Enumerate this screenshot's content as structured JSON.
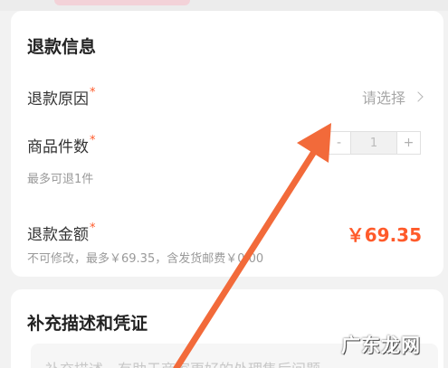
{
  "refund_info": {
    "title": "退款信息",
    "reason_label": "退款原因",
    "reason_placeholder": "请选择",
    "quantity_label": "商品件数",
    "quantity_value": "1",
    "quantity_minus": "-",
    "quantity_plus": "+",
    "quantity_hint": "最多可退1件",
    "amount_label": "退款金额",
    "amount_value": "￥69.35",
    "amount_hint": "不可修改，最多￥69.35，含发货邮费￥0.00",
    "required_mark": "*"
  },
  "supplement": {
    "title": "补充描述和凭证",
    "placeholder": "补充描述，有助于商家更好的处理售后问题"
  },
  "watermark": "广东龙网",
  "colors": {
    "accent": "#ff5a2a",
    "arrow": "#f26a3a"
  }
}
